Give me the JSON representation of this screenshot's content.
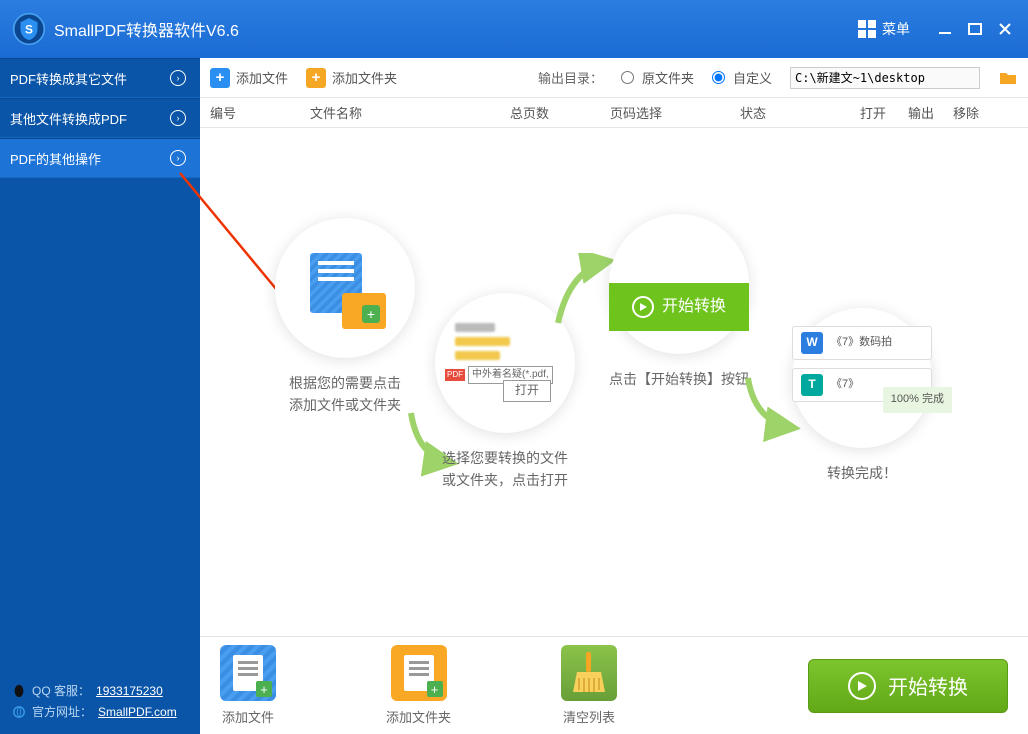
{
  "titlebar": {
    "title": "SmallPDF转换器软件V6.6",
    "menu": "菜单"
  },
  "sidebar": {
    "items": [
      {
        "label": "PDF转换成其它文件"
      },
      {
        "label": "其他文件转换成PDF"
      },
      {
        "label": "PDF的其他操作"
      }
    ]
  },
  "footer": {
    "qq_label": "QQ 客服：",
    "qq_value": "1933175230",
    "site_label": "官方网址：",
    "site_value": "SmallPDF.com"
  },
  "toolbar": {
    "add_file": "添加文件",
    "add_folder": "添加文件夹",
    "output_label": "输出目录：",
    "radio_source": "原文件夹",
    "radio_custom": "自定义",
    "path_value": "C:\\新建文~1\\desktop"
  },
  "table": {
    "cols": {
      "c1": "编号",
      "c2": "文件名称",
      "c3": "总页数",
      "c4": "页码选择",
      "c5": "状态",
      "c6": "打开",
      "c7": "输出",
      "c8": "移除"
    }
  },
  "steps": {
    "s1": "根据您的需要点击\n添加文件或文件夹",
    "s2": "选择您要转换的文件\n或文件夹，点击打开",
    "s2_file": "中外着名疑(*.pdf,",
    "s2_open": "打开",
    "s3_btn": "开始转换",
    "s3": "点击【开始转换】按钮",
    "s4_item1": "《7》数码拍",
    "s4_item2": "《7》",
    "s4_done": "100% 完成",
    "s4": "转换完成！"
  },
  "bottom": {
    "add_file": "添加文件",
    "add_folder": "添加文件夹",
    "clear": "清空列表",
    "start": "开始转换"
  }
}
